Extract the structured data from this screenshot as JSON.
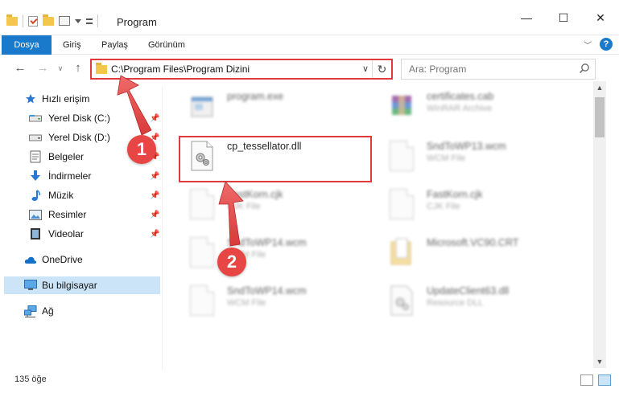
{
  "window": {
    "title": "Program",
    "controls": {
      "minimize": "—",
      "maximize": "☐",
      "close": "✕"
    }
  },
  "ribbon": {
    "tabs": [
      "Dosya",
      "Giriş",
      "Paylaş",
      "Görünüm"
    ],
    "help": "?"
  },
  "address": {
    "path": "C:\\Program Files\\Program Dizini",
    "search_placeholder": "Ara: Program"
  },
  "sidebar": {
    "quick_access": "Hızlı erişim",
    "items": [
      {
        "label": "Yerel Disk (C:)",
        "icon": "drive-icon",
        "pinned": true
      },
      {
        "label": "Yerel Disk (D:)",
        "icon": "drive-icon",
        "pinned": true
      },
      {
        "label": "Belgeler",
        "icon": "documents-icon",
        "pinned": true
      },
      {
        "label": "İndirmeler",
        "icon": "download-icon",
        "pinned": true
      },
      {
        "label": "Müzik",
        "icon": "music-icon",
        "pinned": true
      },
      {
        "label": "Resimler",
        "icon": "pictures-icon",
        "pinned": true
      },
      {
        "label": "Videolar",
        "icon": "video-icon",
        "pinned": true
      }
    ],
    "onedrive": "OneDrive",
    "this_pc": "Bu bilgisayar",
    "network": "Ağ"
  },
  "files": [
    {
      "name": "program.exe",
      "desc": "",
      "icon": "exe-icon"
    },
    {
      "name": "certificates.cab",
      "desc": "WinRAR Archive",
      "icon": "archive-icon"
    },
    {
      "name": "cp_tessellator.dll",
      "desc": "",
      "icon": "dll-icon"
    },
    {
      "name": "SndToWP13.wcm",
      "desc": "WCM File",
      "icon": "file-icon"
    },
    {
      "name": "FastKorn.cjk",
      "desc": "CJK File",
      "icon": "file-icon"
    },
    {
      "name": "FastKorn.cjk",
      "desc": "CJK File",
      "icon": "file-icon"
    },
    {
      "name": "SndToWP14.wcm",
      "desc": "WCM File",
      "icon": "file-icon"
    },
    {
      "name": "Microsoft.VC90.CRT",
      "desc": "",
      "icon": "folder-icon"
    },
    {
      "name": "SndToWP14.wcm",
      "desc": "WCM File",
      "icon": "file-icon"
    },
    {
      "name": "UpdateClient63.dll",
      "desc": "Resource DLL",
      "icon": "dll-icon"
    }
  ],
  "status": {
    "count": "135 öğe"
  },
  "annotations": {
    "step1": "1",
    "step2": "2"
  },
  "colors": {
    "accent": "#1979ca",
    "highlight": "#e03a3a",
    "badge": "#e84545"
  }
}
